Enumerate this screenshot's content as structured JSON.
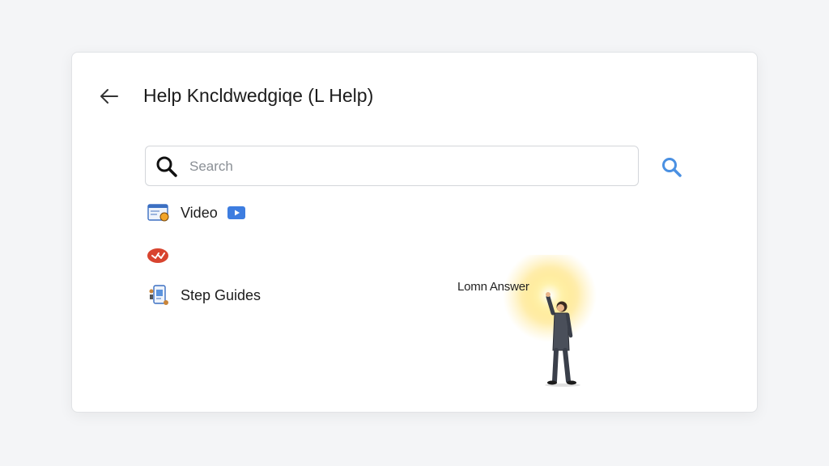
{
  "header": {
    "back_icon": "back-arrow-icon",
    "title": "Help Kncldwedgiqe (L Help)"
  },
  "search": {
    "placeholder": "Search",
    "value": "",
    "icon": "search-icon",
    "button_icon": "search-icon",
    "accent": "#4a90e2"
  },
  "items": [
    {
      "label": "Video",
      "icon": "browser-window-icon",
      "badge_icon": "youtube-play-icon"
    },
    {
      "label": "",
      "icon": "red-badge-icon"
    },
    {
      "label": "Step Guides",
      "icon": "document-guide-icon"
    }
  ],
  "illustration": {
    "label": "Lomn Answer"
  },
  "colors": {
    "background": "#f4f5f7",
    "card": "#ffffff",
    "brand_blue": "#4a90e2",
    "badge_red": "#d8442f",
    "glow": "#ffd84a"
  }
}
